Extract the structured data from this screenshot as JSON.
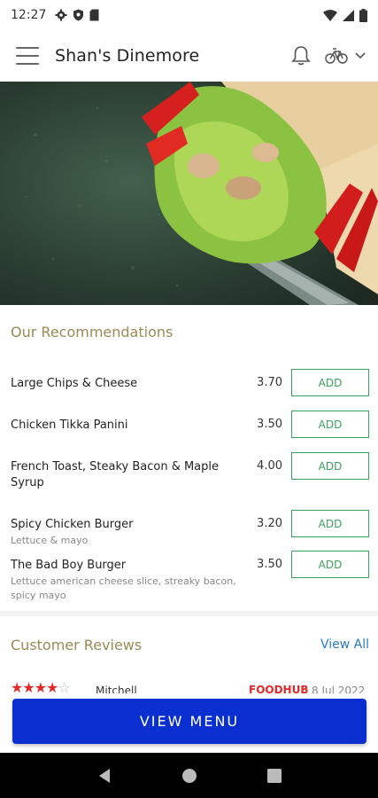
{
  "status_bar": {
    "time": "12:27",
    "left_icons": [
      "gear-icon",
      "shield-icon",
      "sim-card-icon"
    ],
    "right_icons": [
      "wifi-icon",
      "signal-icon",
      "battery-icon"
    ]
  },
  "app_bar": {
    "title": "Shan's Dinemore",
    "icons": [
      "menu-icon",
      "bell-icon",
      "bicycle-icon",
      "chevron-down-icon"
    ]
  },
  "recommendations": {
    "title": "Our Recommendations",
    "items": [
      {
        "name": "Large Chips & Cheese",
        "description": "",
        "price": "3.70",
        "button": "ADD"
      },
      {
        "name": "Chicken Tikka  Panini",
        "description": "",
        "price": "3.50",
        "button": "ADD"
      },
      {
        "name": "French Toast, Steaky Bacon & Maple Syrup",
        "description": "",
        "price": "4.00",
        "button": "ADD"
      },
      {
        "name": "Spicy Chicken Burger",
        "description": "Lettuce & mayo",
        "price": "3.20",
        "button": "ADD"
      },
      {
        "name": "The Bad Boy Burger",
        "description": "Lettuce american cheese slice, streaky bacon, spicy mayo",
        "price": "3.50",
        "button": "ADD"
      }
    ]
  },
  "reviews": {
    "title": "Customer Reviews",
    "view_all": "View All",
    "first_review": {
      "rating": 4,
      "reviewer": "Mitchell",
      "source": "FOODHUB",
      "date": "8 Jul 2022"
    }
  },
  "view_menu_button": "VIEW MENU",
  "colors": {
    "section_title": "#9a8a55",
    "add_button": "#3aa15a",
    "view_all": "#2a7ac0",
    "primary_button": "#0a2fd1",
    "stars": "#e02a2a"
  }
}
